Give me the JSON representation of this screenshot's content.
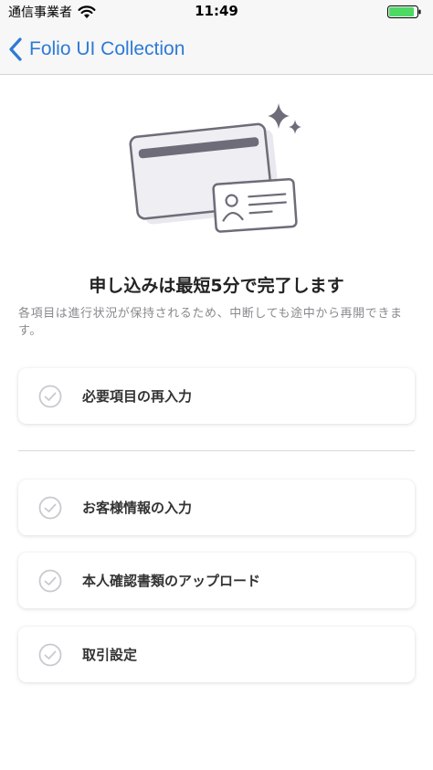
{
  "status_bar": {
    "carrier": "通信事業者",
    "time": "11:49",
    "wifi_icon": "wifi-icon",
    "battery_icon": "battery-icon",
    "battery_color": "#4cd964"
  },
  "nav": {
    "back_icon": "chevron-left-icon",
    "title": "Folio UI Collection",
    "accent_color": "#2d7ad6"
  },
  "hero": {
    "illustration": "card-and-id-illustration",
    "sparkle_icon": "sparkle-icon"
  },
  "main": {
    "headline": "申し込みは最短5分で完了します",
    "description": "各項目は進行状況が保持されるため、中断しても途中から再開できます。"
  },
  "steps": [
    {
      "label": "必要項目の再入力",
      "icon": "check-circle-icon"
    },
    {
      "label": "お客様情報の入力",
      "icon": "check-circle-icon"
    },
    {
      "label": "本人確認書類のアップロード",
      "icon": "check-circle-icon"
    },
    {
      "label": "取引設定",
      "icon": "check-circle-icon"
    }
  ]
}
